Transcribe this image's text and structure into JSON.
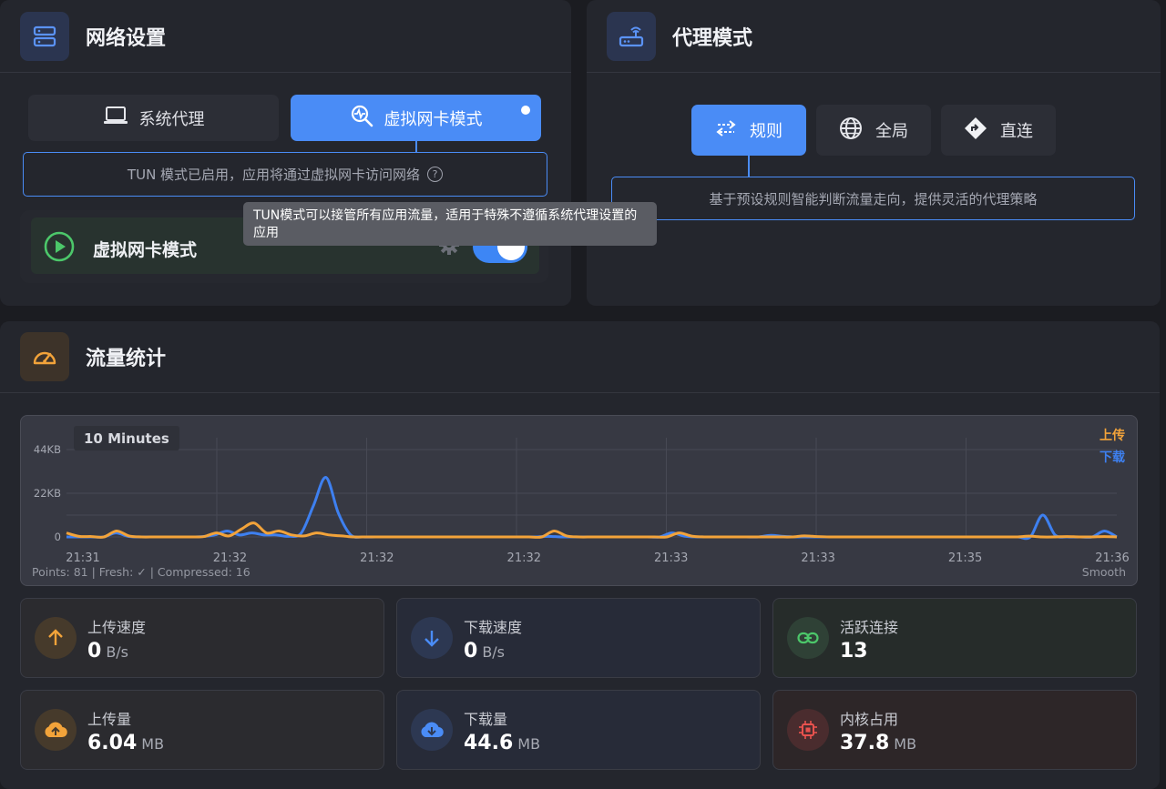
{
  "network": {
    "title": "网络设置",
    "modes": [
      {
        "label": "系统代理",
        "icon": "laptop-icon",
        "active": false
      },
      {
        "label": "虚拟网卡模式",
        "icon": "network-scan-icon",
        "active": true
      }
    ],
    "info": "TUN 模式已启用，应用将通过虚拟网卡访问网络",
    "tun_row_label": "虚拟网卡模式",
    "tun_enabled": true,
    "tooltip": "TUN模式可以接管所有应用流量，适用于特殊不遵循系统代理设置的应用"
  },
  "proxy": {
    "title": "代理模式",
    "modes": [
      {
        "label": "规则",
        "icon": "swap-arrows-icon",
        "active": true
      },
      {
        "label": "全局",
        "icon": "globe-icon",
        "active": false
      },
      {
        "label": "直连",
        "icon": "direction-sign-icon",
        "active": false
      }
    ],
    "info": "基于预设规则智能判断流量走向，提供灵活的代理策略"
  },
  "traffic": {
    "title": "流量统计",
    "range_badge": "10 Minutes",
    "footer_left": "Points: 81 | Fresh: ✓ | Compressed: 16",
    "footer_right": "Smooth",
    "chart_data": {
      "type": "line",
      "y_ticks": [
        "44KB",
        "22KB",
        "0"
      ],
      "ylim": [
        0,
        44
      ],
      "x_ticks": [
        "21:31",
        "21:32",
        "21:32",
        "21:32",
        "21:33",
        "21:33",
        "21:35",
        "21:36"
      ],
      "legend_position": "top-right",
      "series": [
        {
          "name": "上传",
          "color": "#f2a33a",
          "values": [
            2,
            0.3,
            0.2,
            0,
            3,
            0.5,
            0,
            0,
            0,
            0,
            0,
            0.2,
            2,
            0.5,
            4,
            7,
            2,
            3,
            1,
            0.5,
            2,
            1,
            0.5,
            0,
            0,
            0,
            0,
            0,
            0,
            0,
            0,
            0,
            0,
            0,
            0,
            0,
            0,
            0,
            0,
            3,
            0.5,
            0,
            0,
            0,
            0,
            0,
            0,
            0,
            0,
            2,
            0.4,
            0,
            0,
            0,
            0,
            0,
            0,
            0,
            0,
            0.5,
            0.2,
            0,
            0,
            0,
            0,
            0,
            0,
            0,
            0,
            0,
            0,
            0,
            0,
            0,
            0,
            0,
            0,
            0.4,
            0,
            0,
            0.2,
            0,
            0,
            0.2,
            0
          ]
        },
        {
          "name": "下载",
          "color": "#3e80f0",
          "values": [
            0,
            0,
            0,
            0,
            2,
            0.3,
            0,
            0,
            0,
            0,
            0,
            0.2,
            1,
            3,
            1,
            2,
            1,
            1,
            0.3,
            2,
            16,
            30,
            12,
            1,
            0,
            0,
            0,
            0,
            0,
            0,
            0,
            0,
            0,
            0,
            0,
            0,
            0,
            0,
            0,
            0.3,
            0,
            0,
            0,
            0,
            0,
            0,
            0,
            0,
            0,
            2,
            0.4,
            0,
            0,
            0,
            0,
            0,
            0,
            0.8,
            0.3,
            0,
            0,
            0,
            0,
            0,
            0,
            0,
            0,
            0,
            0,
            0,
            0,
            0,
            0,
            0,
            0,
            0,
            0,
            0,
            0,
            11,
            1,
            0,
            0,
            0,
            3,
            0
          ]
        }
      ]
    },
    "stats": [
      {
        "label": "上传速度",
        "value": "0",
        "unit": "B/s",
        "icon": "arrow-up-icon"
      },
      {
        "label": "下载速度",
        "value": "0",
        "unit": "B/s",
        "icon": "arrow-down-icon"
      },
      {
        "label": "活跃连接",
        "value": "13",
        "unit": "",
        "icon": "link-icon"
      },
      {
        "label": "上传量",
        "value": "6.04",
        "unit": "MB",
        "icon": "cloud-upload-icon"
      },
      {
        "label": "下载量",
        "value": "44.6",
        "unit": "MB",
        "icon": "cloud-download-icon"
      },
      {
        "label": "内核占用",
        "value": "37.8",
        "unit": "MB",
        "icon": "cpu-chip-icon"
      }
    ]
  }
}
